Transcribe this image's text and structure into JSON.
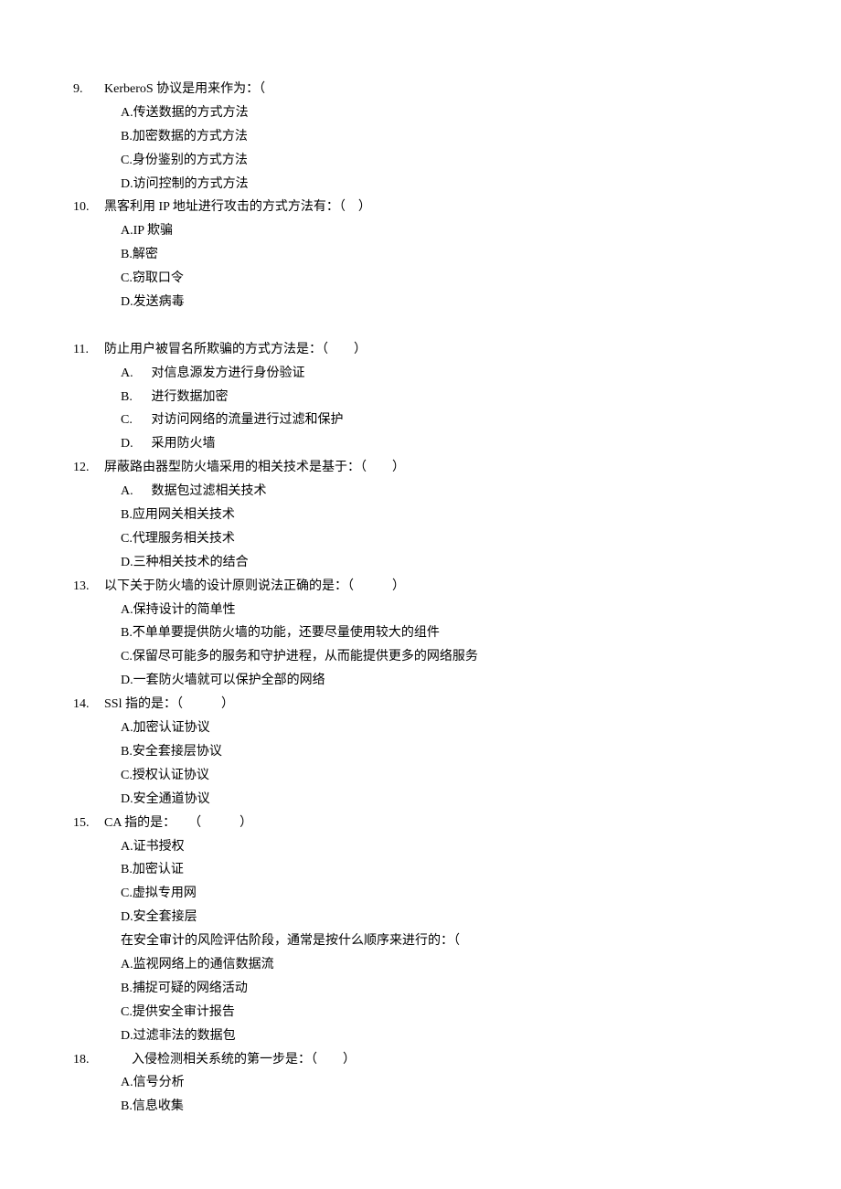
{
  "questions": [
    {
      "num": "9.",
      "stem": "KerberoS 协议是用来作为：（",
      "opts": [
        "A.传送数据的方式方法",
        "B.加密数据的方式方法",
        "C.身份鉴别的方式方法",
        "D.访问控制的方式方法"
      ]
    },
    {
      "num": "10.",
      "stem": "黑客利用 IP 地址进行攻击的方式方法有：（ ）",
      "opts": [
        "A.IP 欺骗",
        "B.解密",
        "C.窃取口令",
        "D.发送病毒"
      ]
    },
    {
      "num": "11.",
      "stem": "防止用户被冒名所欺骗的方式方法是：（  ）",
      "opts_wide": [
        {
          "l": "A.",
          "t": "对信息源发方进行身份验证"
        },
        {
          "l": "B.",
          "t": "进行数据加密"
        },
        {
          "l": "C.",
          "t": "对访问网络的流量进行过滤和保护"
        },
        {
          "l": "D.",
          "t": "采用防火墙"
        }
      ]
    },
    {
      "num": "12.",
      "stem": "屏蔽路由器型防火墙采用的相关技术是基于：（  ）",
      "opts_wide_first": {
        "l": "A.",
        "t": "数据包过滤相关技术"
      },
      "opts_rest": [
        "B.应用网关相关技术",
        "C.代理服务相关技术",
        "D.三种相关技术的结合"
      ]
    },
    {
      "num": "13.",
      "stem": "以下关于防火墙的设计原则说法正确的是：（   ）",
      "opts": [
        "A.保持设计的简单性",
        "B.不单单要提供防火墙的功能，还要尽量使用较大的组件",
        "C.保留尽可能多的服务和守护进程，从而能提供更多的网络服务",
        "D.一套防火墙就可以保护全部的网络"
      ]
    },
    {
      "num": "14.",
      "stem": "SSl 指的是：（   ）",
      "opts": [
        "A.加密认证协议",
        "B.安全套接层协议",
        "C.授权认证协议",
        "D.安全通道协议"
      ]
    },
    {
      "num": "15.",
      "stem": "CA 指的是： （   ）",
      "opts": [
        "A.证书授权",
        "B.加密认证",
        "C.虚拟专用网",
        "D.安全套接层"
      ]
    },
    {
      "after15_stem": "在安全审计的风险评估阶段，通常是按什么顺序来进行的：（",
      "after15_opts": [
        "A.监视网络上的通信数据流",
        "B.捕捉可疑的网络活动",
        "C.提供安全审计报告",
        "D.过滤非法的数据包"
      ]
    },
    {
      "num": "18.",
      "stem": " 入侵检测相关系统的第一步是：（  ）",
      "opts": [
        "A.信号分析",
        "B.信息收集"
      ]
    }
  ]
}
